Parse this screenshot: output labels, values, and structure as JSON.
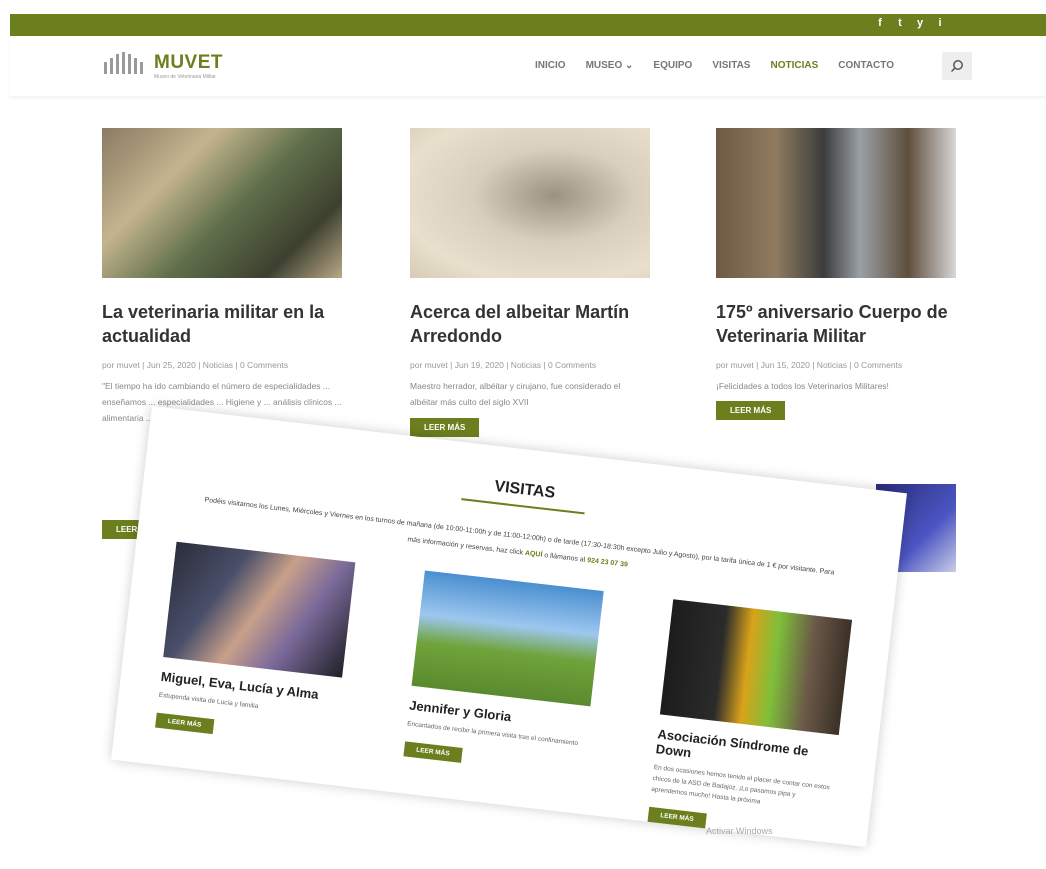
{
  "social_icons": [
    "f",
    "t",
    "y",
    "i"
  ],
  "logo": {
    "name": "MUVET",
    "tagline": "Museo de Veterinaria Militar"
  },
  "nav": {
    "items": [
      "INICIO",
      "MUSEO",
      "EQUIPO",
      "VISITAS",
      "NOTICIAS",
      "CONTACTO"
    ],
    "museo_caret": "⌄",
    "active": "NOTICIAS"
  },
  "posts": [
    {
      "title": "La veterinaria militar en la actualidad",
      "meta": "por muvet | Jun 25, 2020 | Noticias | 0 Comments",
      "excerpt": "\"El tiempo ha ido cambiando el número de especialidades ... enseñamos ... especialidades ... Higiene y ... análisis clínicos ... alimentaria ... reproducción ...",
      "button": "LEER MÁS"
    },
    {
      "title": "Acerca del albeitar Martín Arredondo",
      "meta": "por muvet | Jun 19, 2020 | Noticias | 0 Comments",
      "excerpt": "Maestro herrador, albéitar y cirujano, fue considerado el albéitar más culto del siglo XVII",
      "button": "LEER MÁS"
    },
    {
      "title": "175º aniversario Cuerpo de Veterinaria Militar",
      "meta": "por muvet | Jun 15, 2020 | Noticias | 0 Comments",
      "excerpt": "¡Felicidades a todos los Veterinarios Militares!",
      "button": "LEER MÁS"
    }
  ],
  "visitas": {
    "title": "VISITAS",
    "intro_pre": "Podéis visitarnos los Lunes, Miércoles y Viernes en los turnos de mañana (de 10:00-11:00h y de 11:00-12:00h) o de tarde (17:30-18:30h excepto Julio y Agosto), por la tarifa única de 1 € por visitante. Para más información y reservas, haz click",
    "intro_link": "AQUÍ",
    "intro_mid": "o llámanos al",
    "intro_phone": "924 23 07 39",
    "cards": [
      {
        "title": "Miguel, Eva, Lucía y Alma",
        "text": "Estupenda visita de Lucía y familia",
        "button": "LEER MÁS"
      },
      {
        "title": "Jennifer y Gloria",
        "text": "Encantados de recibir la primera visita tras el confinamiento",
        "button": "LEER MÁS"
      },
      {
        "title": "Asociación Síndrome de Down",
        "text": "En dos ocasiones hemos tenido el placer de contar con estos chicos de la ASD de Badajoz. ¡Lo pasamos pipa y aprendemos mucho! Hasta la próxima",
        "button": "LEER MÁS"
      }
    ]
  },
  "watermark": "Activar Windows"
}
